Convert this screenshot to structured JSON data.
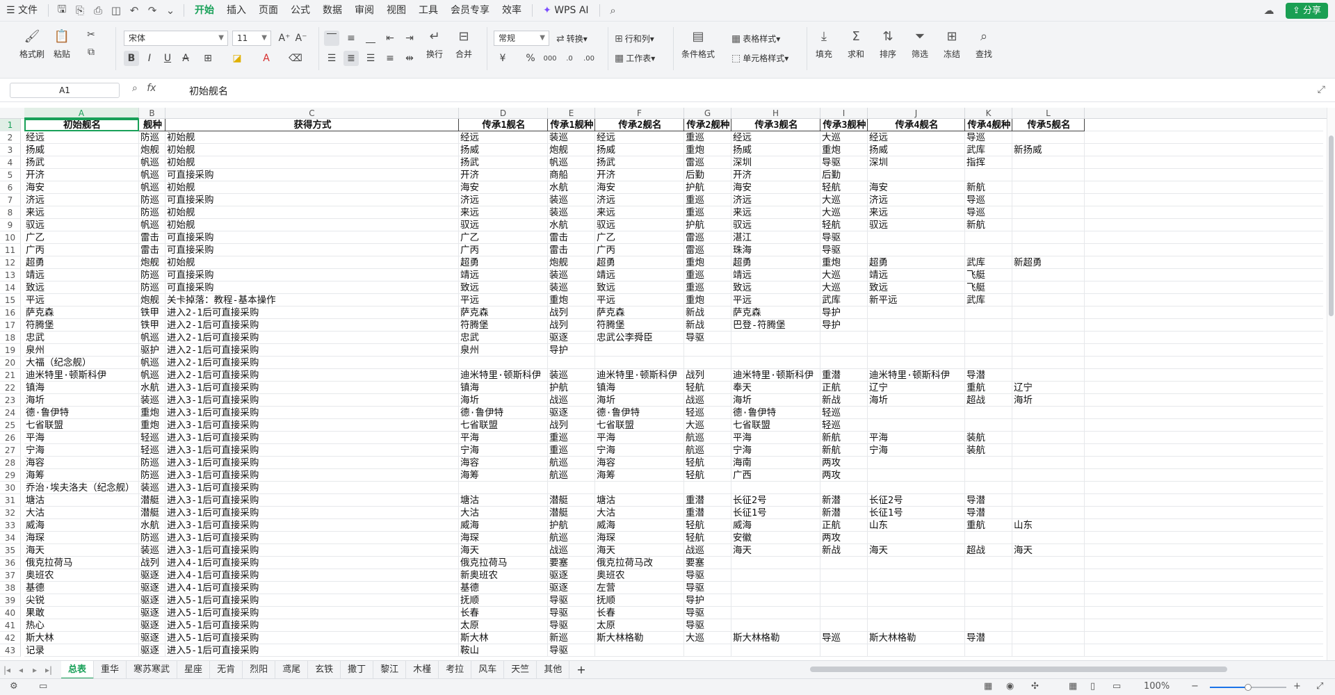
{
  "menubar": {
    "file": "文件",
    "tabs": [
      "开始",
      "插入",
      "页面",
      "公式",
      "数据",
      "审阅",
      "视图",
      "工具",
      "会员专享",
      "效率"
    ],
    "active_tab": "开始",
    "wps_ai": "WPS AI",
    "share": "分享"
  },
  "ribbon": {
    "format_painter": "格式刷",
    "paste": "粘贴",
    "font_name": "宋体",
    "font_size": "11",
    "number_format": "常规",
    "convert": "转换",
    "row_col": "行和列",
    "worksheet": "工作表",
    "wrap": "换行",
    "merge": "合并",
    "conditional_format": "条件格式",
    "table_style": "表格样式",
    "cell_style": "单元格样式",
    "fill": "填充",
    "sum": "求和",
    "sort": "排序",
    "filter": "筛选",
    "freeze": "冻结",
    "find": "查找",
    "bold": "B",
    "italic": "I",
    "underline": "U",
    "strike": "A",
    "percent": "%"
  },
  "formula_bar": {
    "name_box": "A1",
    "fx": "fx",
    "content": "初始舰名"
  },
  "columns": [
    "A",
    "B",
    "C",
    "D",
    "E",
    "F",
    "G",
    "H",
    "I",
    "J",
    "K",
    "L"
  ],
  "selected_column": "A",
  "rows": [
    [
      "初始舰名",
      "舰种",
      "获得方式",
      "传承1舰名",
      "传承1舰种",
      "传承2舰名",
      "传承2舰种",
      "传承3舰名",
      "传承3舰种",
      "传承4舰名",
      "传承4舰种",
      "传承5舰名"
    ],
    [
      "经远",
      "防巡",
      "初始舰",
      "经远",
      "装巡",
      "经远",
      "重巡",
      "经远",
      "大巡",
      "经远",
      "导巡",
      ""
    ],
    [
      "扬威",
      "炮舰",
      "初始舰",
      "扬威",
      "炮舰",
      "扬威",
      "重炮",
      "扬威",
      "重炮",
      "扬威",
      "武库",
      "新扬威"
    ],
    [
      "扬武",
      "帆巡",
      "初始舰",
      "扬武",
      "帆巡",
      "扬武",
      "雷巡",
      "深圳",
      "导驱",
      "深圳",
      "指挥",
      ""
    ],
    [
      "开济",
      "帆巡",
      "可直接采购",
      "开济",
      "商船",
      "开济",
      "后勤",
      "开济",
      "后勤",
      "",
      "",
      ""
    ],
    [
      "海安",
      "帆巡",
      "初始舰",
      "海安",
      "水航",
      "海安",
      "护航",
      "海安",
      "轻航",
      "海安",
      "新航",
      ""
    ],
    [
      "济远",
      "防巡",
      "可直接采购",
      "济远",
      "装巡",
      "济远",
      "重巡",
      "济远",
      "大巡",
      "济远",
      "导巡",
      ""
    ],
    [
      "来远",
      "防巡",
      "初始舰",
      "来远",
      "装巡",
      "来远",
      "重巡",
      "来远",
      "大巡",
      "来远",
      "导巡",
      ""
    ],
    [
      "驭远",
      "帆巡",
      "初始舰",
      "驭远",
      "水航",
      "驭远",
      "护航",
      "驭远",
      "轻航",
      "驭远",
      "新航",
      ""
    ],
    [
      "广乙",
      "雷击",
      "可直接采购",
      "广乙",
      "雷击",
      "广乙",
      "雷巡",
      "湛江",
      "导驱",
      "",
      "",
      ""
    ],
    [
      "广丙",
      "雷击",
      "可直接采购",
      "广丙",
      "雷击",
      "广丙",
      "雷巡",
      "珠海",
      "导驱",
      "",
      "",
      ""
    ],
    [
      "超勇",
      "炮舰",
      "初始舰",
      "超勇",
      "炮舰",
      "超勇",
      "重炮",
      "超勇",
      "重炮",
      "超勇",
      "武库",
      "新超勇"
    ],
    [
      "靖远",
      "防巡",
      "可直接采购",
      "靖远",
      "装巡",
      "靖远",
      "重巡",
      "靖远",
      "大巡",
      "靖远",
      "飞艇",
      ""
    ],
    [
      "致远",
      "防巡",
      "可直接采购",
      "致远",
      "装巡",
      "致远",
      "重巡",
      "致远",
      "大巡",
      "致远",
      "飞艇",
      ""
    ],
    [
      "平远",
      "炮舰",
      "关卡掉落：教程-基本操作",
      "平远",
      "重炮",
      "平远",
      "重炮",
      "平远",
      "武库",
      "新平远",
      "武库",
      ""
    ],
    [
      "萨克森",
      "铁甲",
      "进入2-1后可直接采购",
      "萨克森",
      "战列",
      "萨克森",
      "新战",
      "萨克森",
      "导护",
      "",
      "",
      ""
    ],
    [
      "符腾堡",
      "铁甲",
      "进入2-1后可直接采购",
      "符腾堡",
      "战列",
      "符腾堡",
      "新战",
      "巴登-符腾堡",
      "导护",
      "",
      "",
      ""
    ],
    [
      "忠武",
      "帆巡",
      "进入2-1后可直接采购",
      "忠武",
      "驱逐",
      "忠武公李舜臣",
      "导驱",
      "",
      "",
      "",
      "",
      ""
    ],
    [
      "泉州",
      "驱护",
      "进入2-1后可直接采购",
      "泉州",
      "导护",
      "",
      "",
      "",
      "",
      "",
      "",
      ""
    ],
    [
      "大福（纪念舰）",
      "帆巡",
      "进入2-1后可直接采购",
      "",
      "",
      "",
      "",
      "",
      "",
      "",
      "",
      ""
    ],
    [
      "迪米特里·顿斯科伊",
      "帆巡",
      "进入2-1后可直接采购",
      "迪米特里·顿斯科伊",
      "装巡",
      "迪米特里·顿斯科伊",
      "战列",
      "迪米特里·顿斯科伊",
      "重潜",
      "迪米特里·顿斯科伊",
      "导潜",
      ""
    ],
    [
      "镇海",
      "水航",
      "进入3-1后可直接采购",
      "镇海",
      "护航",
      "镇海",
      "轻航",
      "奉天",
      "正航",
      "辽宁",
      "重航",
      "辽宁"
    ],
    [
      "海圻",
      "装巡",
      "进入3-1后可直接采购",
      "海圻",
      "战巡",
      "海圻",
      "战巡",
      "海圻",
      "新战",
      "海圻",
      "超战",
      "海圻"
    ],
    [
      "德·鲁伊特",
      "重炮",
      "进入3-1后可直接采购",
      "德·鲁伊特",
      "驱逐",
      "德·鲁伊特",
      "轻巡",
      "德·鲁伊特",
      "轻巡",
      "",
      "",
      ""
    ],
    [
      "七省联盟",
      "重炮",
      "进入3-1后可直接采购",
      "七省联盟",
      "战列",
      "七省联盟",
      "大巡",
      "七省联盟",
      "轻巡",
      "",
      "",
      ""
    ],
    [
      "平海",
      "轻巡",
      "进入3-1后可直接采购",
      "平海",
      "重巡",
      "平海",
      "航巡",
      "平海",
      "新航",
      "平海",
      "装航",
      ""
    ],
    [
      "宁海",
      "轻巡",
      "进入3-1后可直接采购",
      "宁海",
      "重巡",
      "宁海",
      "航巡",
      "宁海",
      "新航",
      "宁海",
      "装航",
      ""
    ],
    [
      "海容",
      "防巡",
      "进入3-1后可直接采购",
      "海容",
      "航巡",
      "海容",
      "轻航",
      "海南",
      "两攻",
      "",
      "",
      ""
    ],
    [
      "海筹",
      "防巡",
      "进入3-1后可直接采购",
      "海筹",
      "航巡",
      "海筹",
      "轻航",
      "广西",
      "两攻",
      "",
      "",
      ""
    ],
    [
      "乔治·埃夫洛夫（纪念舰）",
      "装巡",
      "进入3-1后可直接采购",
      "",
      "",
      "",
      "",
      "",
      "",
      "",
      "",
      ""
    ],
    [
      "塘沽",
      "潜艇",
      "进入3-1后可直接采购",
      "塘沽",
      "潜艇",
      "塘沽",
      "重潜",
      "长征2号",
      "新潜",
      "长征2号",
      "导潜",
      ""
    ],
    [
      "大沽",
      "潜艇",
      "进入3-1后可直接采购",
      "大沽",
      "潜艇",
      "大沽",
      "重潜",
      "长征1号",
      "新潜",
      "长征1号",
      "导潜",
      ""
    ],
    [
      "威海",
      "水航",
      "进入3-1后可直接采购",
      "威海",
      "护航",
      "威海",
      "轻航",
      "威海",
      "正航",
      "山东",
      "重航",
      "山东"
    ],
    [
      "海琛",
      "防巡",
      "进入3-1后可直接采购",
      "海琛",
      "航巡",
      "海琛",
      "轻航",
      "安徽",
      "两攻",
      "",
      "",
      ""
    ],
    [
      "海天",
      "装巡",
      "进入3-1后可直接采购",
      "海天",
      "战巡",
      "海天",
      "战巡",
      "海天",
      "新战",
      "海天",
      "超战",
      "海天"
    ],
    [
      "俄克拉荷马",
      "战列",
      "进入4-1后可直接采购",
      "俄克拉荷马",
      "要塞",
      "俄克拉荷马改",
      "要塞",
      "",
      "",
      "",
      "",
      ""
    ],
    [
      "奥班农",
      "驱逐",
      "进入4-1后可直接采购",
      "新奥班农",
      "驱逐",
      "奥班农",
      "导驱",
      "",
      "",
      "",
      "",
      ""
    ],
    [
      "基德",
      "驱逐",
      "进入4-1后可直接采购",
      "基德",
      "驱逐",
      "左营",
      "导驱",
      "",
      "",
      "",
      "",
      ""
    ],
    [
      "尖锐",
      "驱逐",
      "进入5-1后可直接采购",
      "抚顺",
      "导驱",
      "抚顺",
      "导护",
      "",
      "",
      "",
      "",
      ""
    ],
    [
      "果敢",
      "驱逐",
      "进入5-1后可直接采购",
      "长春",
      "导驱",
      "长春",
      "导驱",
      "",
      "",
      "",
      "",
      ""
    ],
    [
      "热心",
      "驱逐",
      "进入5-1后可直接采购",
      "太原",
      "导驱",
      "太原",
      "导驱",
      "",
      "",
      "",
      "",
      ""
    ],
    [
      "斯大林",
      "驱逐",
      "进入5-1后可直接采购",
      "斯大林",
      "新巡",
      "斯大林格勒",
      "大巡",
      "斯大林格勒",
      "导巡",
      "斯大林格勒",
      "导潜",
      ""
    ],
    [
      "记录",
      "驱逐",
      "进入5-1后可直接采购",
      "鞍山",
      "导驱",
      "",
      "",
      "",
      "",
      "",
      "",
      ""
    ]
  ],
  "sheet_tabs": [
    "总表",
    "重华",
    "寒苏寒武",
    "星座",
    "无肯",
    "烈阳",
    "鸢尾",
    "玄铁",
    "撒丁",
    "黎江",
    "木槿",
    "考拉",
    "风车",
    "天竺",
    "其他"
  ],
  "active_sheet": "总表",
  "add_sheet": "+",
  "status": {
    "zoom": "100%",
    "zoom_fraction": 0.5
  }
}
